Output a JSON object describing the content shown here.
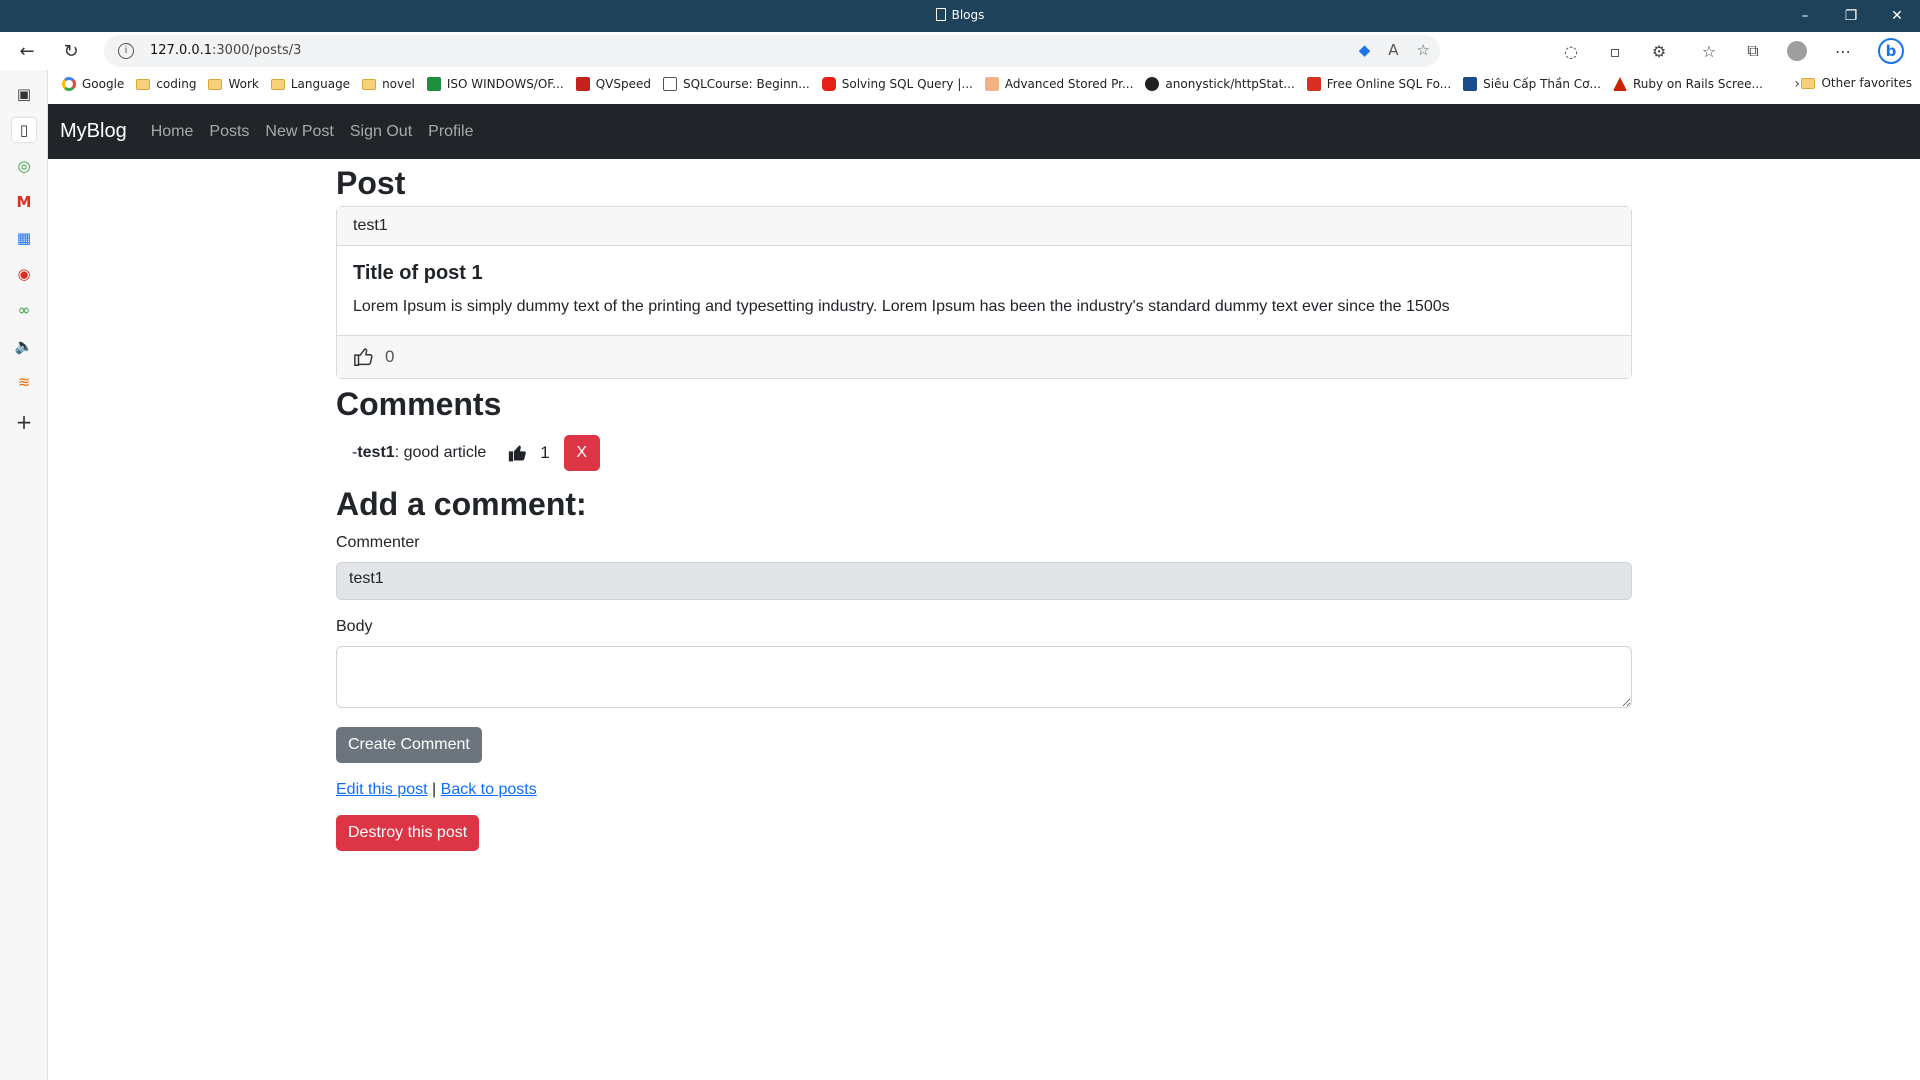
{
  "window": {
    "title": "Blogs",
    "minimize": "–",
    "restore": "❐",
    "close": "✕"
  },
  "toolbar": {
    "url_host": "127.0.0.1",
    "url_path": ":3000/posts/3"
  },
  "bookmarks": [
    {
      "label": "Google",
      "type": "google"
    },
    {
      "label": "coding",
      "type": "folder"
    },
    {
      "label": "Work",
      "type": "folder"
    },
    {
      "label": "Language",
      "type": "folder"
    },
    {
      "label": "novel",
      "type": "folder"
    },
    {
      "label": "ISO WINDOWS/OF...",
      "type": "green"
    },
    {
      "label": "QVSpeed",
      "type": "red"
    },
    {
      "label": "SQLCourse: Beginn...",
      "type": "page"
    },
    {
      "label": "Solving SQL Query |...",
      "type": "youtube"
    },
    {
      "label": "Advanced Stored Pr...",
      "type": "orange"
    },
    {
      "label": "anonystick/httpStat...",
      "type": "github"
    },
    {
      "label": "Free Online SQL Fo...",
      "type": "redsq"
    },
    {
      "label": "Siêu Cấp Thần Cơ...",
      "type": "blue"
    },
    {
      "label": "Ruby on Rails Scree...",
      "type": "triangle"
    }
  ],
  "bookmarks_other": "Other favorites",
  "app": {
    "brand": "MyBlog",
    "nav": [
      "Home",
      "Posts",
      "New Post",
      "Sign Out",
      "Profile"
    ]
  },
  "post": {
    "heading": "Post",
    "author": "test1",
    "title": "Title of post 1",
    "body": "Lorem Ipsum is simply dummy text of the printing and typesetting industry. Lorem Ipsum has been the industry's standard dummy text ever since the 1500s",
    "likes": "0"
  },
  "comments": {
    "heading": "Comments",
    "items": [
      {
        "prefix": "- ",
        "commenter": "test1",
        "body": ": good article",
        "likes": "1",
        "delete_label": "X"
      }
    ]
  },
  "form": {
    "heading": "Add a comment:",
    "commenter_label": "Commenter",
    "commenter_value": "test1",
    "body_label": "Body",
    "body_value": "",
    "submit_label": "Create Comment"
  },
  "links": {
    "edit": "Edit this post",
    "sep": " | ",
    "back": "Back to posts"
  },
  "destroy_label": "Destroy this post"
}
